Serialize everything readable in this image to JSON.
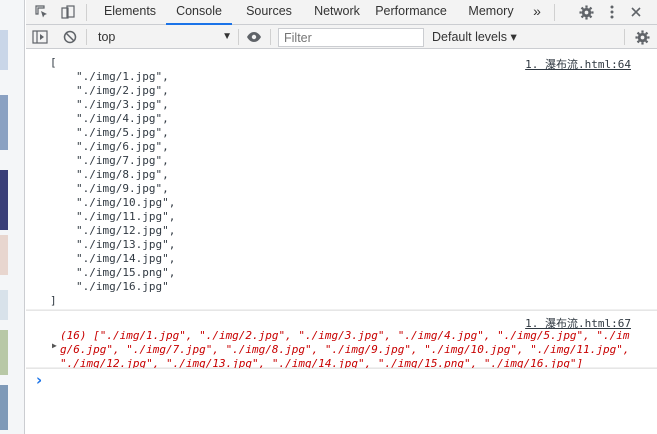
{
  "tabs": [
    {
      "label": "Elements"
    },
    {
      "label": "Console"
    },
    {
      "label": "Sources"
    },
    {
      "label": "Network"
    },
    {
      "label": "Performance"
    },
    {
      "label": "Memory"
    }
  ],
  "tab_overflow": "»",
  "toolbar": {
    "context": "top",
    "filter_placeholder": "Filter",
    "levels": "Default levels ▾"
  },
  "messages": [
    {
      "source": "1. 瀑布流.html:64",
      "open_bracket": "[",
      "items": [
        "\"./img/1.jpg\",",
        "\"./img/2.jpg\",",
        "\"./img/3.jpg\",",
        "\"./img/4.jpg\",",
        "\"./img/5.jpg\",",
        "\"./img/6.jpg\",",
        "\"./img/7.jpg\",",
        "\"./img/8.jpg\",",
        "\"./img/9.jpg\",",
        "\"./img/10.jpg\",",
        "\"./img/11.jpg\",",
        "\"./img/12.jpg\",",
        "\"./img/13.jpg\",",
        "\"./img/14.jpg\",",
        "\"./img/15.png\",",
        "\"./img/16.jpg\""
      ],
      "close_bracket": "]"
    },
    {
      "source": "1. 瀑布流.html:67",
      "lines": [
        "(16) [\"./img/1.jpg\", \"./img/2.jpg\", \"./img/3.jpg\", \"./img/4.jpg\", \"./img/5.jpg\", \"./im",
        "g/6.jpg\", \"./img/7.jpg\", \"./img/8.jpg\", \"./img/9.jpg\", \"./img/10.jpg\", \"./img/11.jpg\",",
        "\"./img/12.jpg\", \"./img/13.jpg\", \"./img/14.jpg\", \"./img/15.png\", \"./img/16.jpg\"]"
      ]
    }
  ],
  "prompt": "›",
  "colors": {
    "active_tab_underline": "#1a73e8",
    "error_text": "#c80000",
    "prompt_blue": "#1a73e8"
  }
}
